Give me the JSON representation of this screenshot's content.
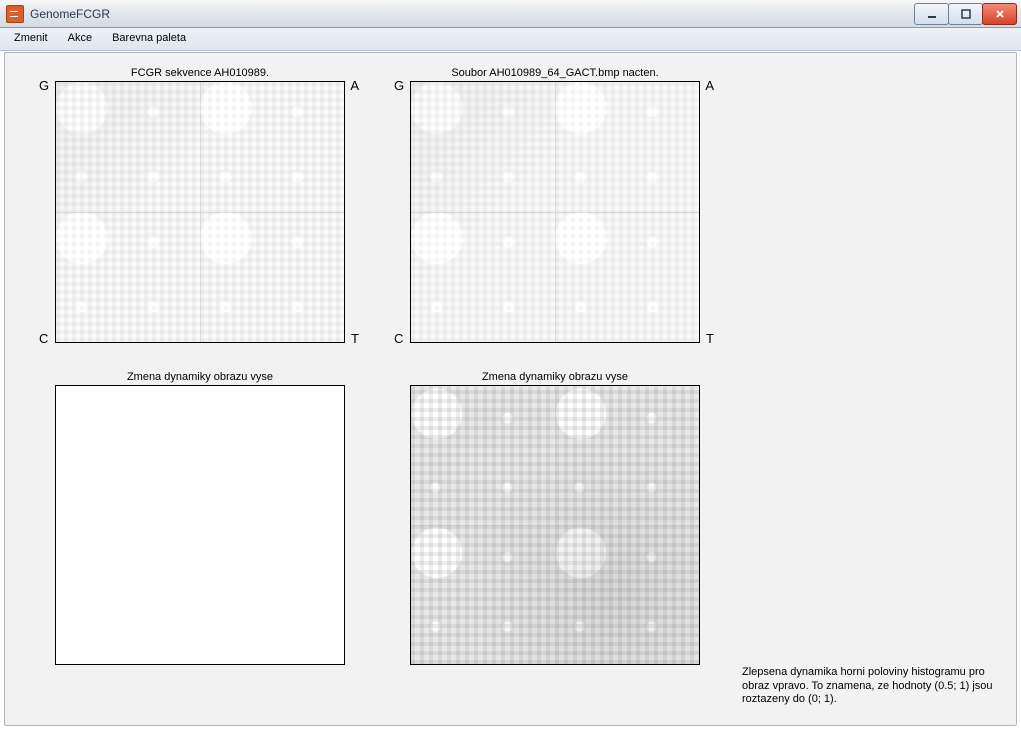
{
  "window": {
    "title": "GenomeFCGR"
  },
  "menubar": {
    "items": [
      {
        "label": "Zmenit"
      },
      {
        "label": "Akce"
      },
      {
        "label": "Barevna paleta"
      }
    ]
  },
  "plots": {
    "top_left": {
      "title": "FCGR sekvence AH010989.",
      "corners": {
        "tl": "G",
        "tr": "A",
        "bl": "C",
        "br": "T"
      }
    },
    "top_right": {
      "title": "Soubor AH010989_64_GACT.bmp nacten.",
      "corners": {
        "tl": "G",
        "tr": "A",
        "bl": "C",
        "br": "T"
      }
    },
    "bottom_left": {
      "title": "Zmena dynamiky obrazu vyse"
    },
    "bottom_right": {
      "title": "Zmena dynamiky obrazu vyse"
    }
  },
  "status": {
    "text": "Zlepsena dynamika horni poloviny histogramu pro obraz vpravo. To znamena, ze hodnoty (0.5; 1) jsou roztazeny do (0; 1)."
  },
  "window_controls": {
    "minimize": "Minimize",
    "maximize": "Maximize",
    "close": "Close"
  }
}
